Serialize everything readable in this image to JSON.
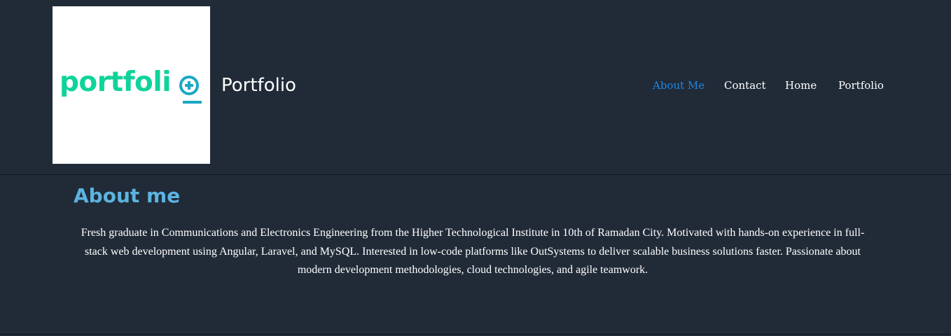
{
  "header": {
    "logo_text": "portfoli",
    "logo_icon": "plus-circle-icon",
    "site_title": "Portfolio"
  },
  "nav": {
    "items": [
      {
        "label": "About Me",
        "active": true
      },
      {
        "label": "Contact",
        "active": false
      },
      {
        "label": "Home",
        "active": false
      },
      {
        "label": "Portfolio",
        "active": false
      }
    ]
  },
  "about": {
    "title": "About me",
    "text": "Fresh graduate in Communications and Electronics Engineering from the Higher Technological Institute in 10th of Ramadan City. Motivated with hands-on experience in full-stack web development using Angular, Laravel, and MySQL. Interested in low-code platforms like OutSystems to deliver scalable business solutions faster. Passionate about modern development methodologies, cloud technologies, and agile teamwork."
  },
  "colors": {
    "background": "#212b38",
    "nav_active": "#1f86e0",
    "about_title": "#5db3e0",
    "logo_green": "#0fd39a",
    "logo_blue": "#1aa8c4"
  }
}
